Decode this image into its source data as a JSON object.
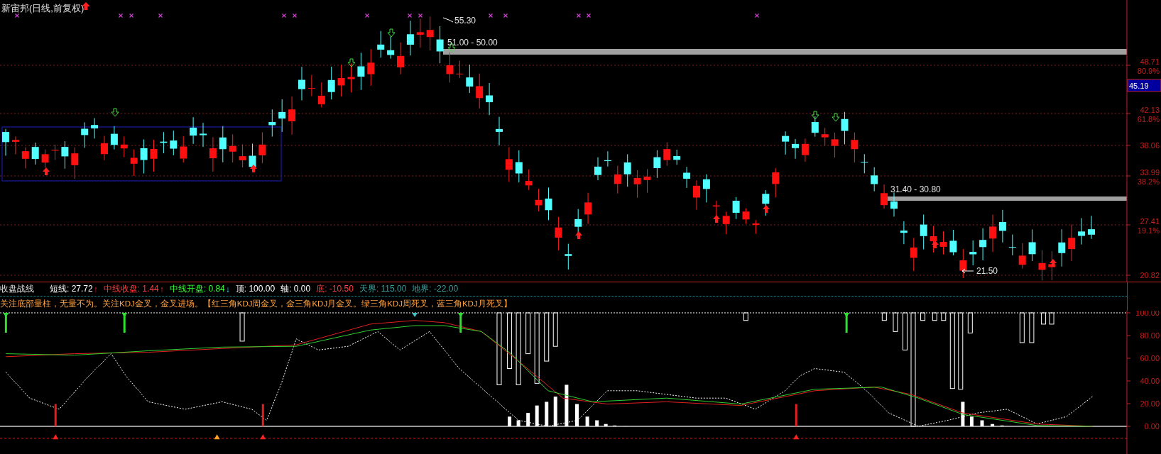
{
  "chart_title": "新宙邦(日线,前复权)",
  "price_labels": [
    {
      "kind": "high",
      "text": "55.30"
    },
    {
      "kind": "zone",
      "text": "51.00 - 50.00"
    },
    {
      "kind": "zone",
      "text": "31.40 - 30.80"
    },
    {
      "kind": "low",
      "text": "21.50"
    }
  ],
  "price_axis": [
    {
      "value": "48.71",
      "ratio": "80.9%"
    },
    {
      "value": "42.13",
      "ratio": "61.8%"
    },
    {
      "value": "38.06"
    },
    {
      "value": "33.99",
      "ratio": "38.2%"
    },
    {
      "value": "27.41",
      "ratio": "19.1%"
    },
    {
      "value": "20.82"
    }
  ],
  "current_price": "45.19",
  "indicator": {
    "name": "收盘战线",
    "items": [
      {
        "kind": "short",
        "text": "短线: 27.72",
        "arrow": "↑"
      },
      {
        "kind": "close",
        "text": "中线收盘: 1.44",
        "arrow": "↑"
      },
      {
        "kind": "open",
        "text": "中线开盘: 0.84",
        "arrow": "↓"
      },
      {
        "kind": "top",
        "text": "顶: 100.00"
      },
      {
        "kind": "axis",
        "text": "轴: 0.00"
      },
      {
        "kind": "bottom",
        "text": "底: -10.50"
      },
      {
        "kind": "sky",
        "text": "天界: 115.00"
      },
      {
        "kind": "ground",
        "text": "地界: -22.00"
      }
    ],
    "note": "关注底部量柱，无量不为。关注KDJ金叉，金叉进场。【红三角KDJ周金叉，金三角KDJ月金叉。绿三角KDJ周死叉，蓝三角KDJ月死叉】",
    "axis": [
      "100.00",
      "80.00",
      "60.00",
      "40.00",
      "20.00",
      "0.00"
    ]
  }
}
